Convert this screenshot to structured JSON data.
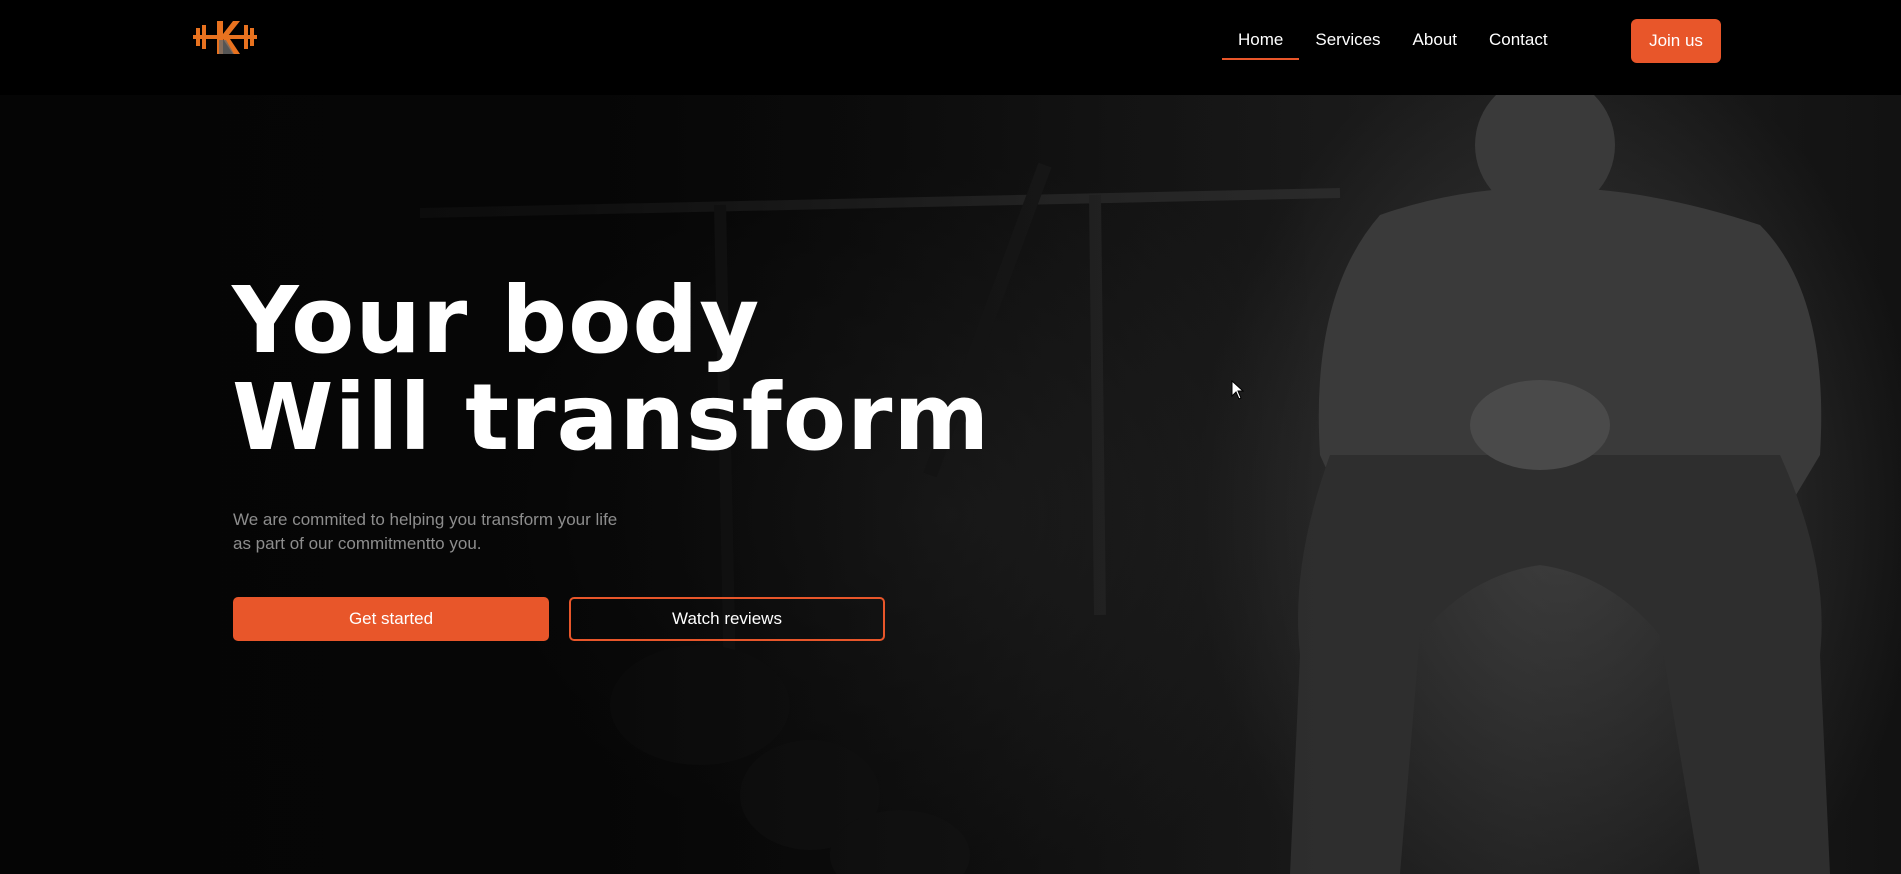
{
  "brand": {
    "logo_icon": "dumbbell-k-logo",
    "accent": "#e8562a"
  },
  "nav": {
    "items": [
      {
        "label": "Home",
        "active": true
      },
      {
        "label": "Services",
        "active": false
      },
      {
        "label": "About",
        "active": false
      },
      {
        "label": "Contact",
        "active": false
      }
    ],
    "cta_label": "Join us"
  },
  "hero": {
    "headline_line1": "Your body",
    "headline_line2": "Will transform",
    "subtext_line1": "We are commited to helping you transform your life",
    "subtext_line2": "as part of our commitmentto you.",
    "primary_button": "Get started",
    "secondary_button": "Watch reviews",
    "background_image": "gym-bodybuilder-photo"
  }
}
